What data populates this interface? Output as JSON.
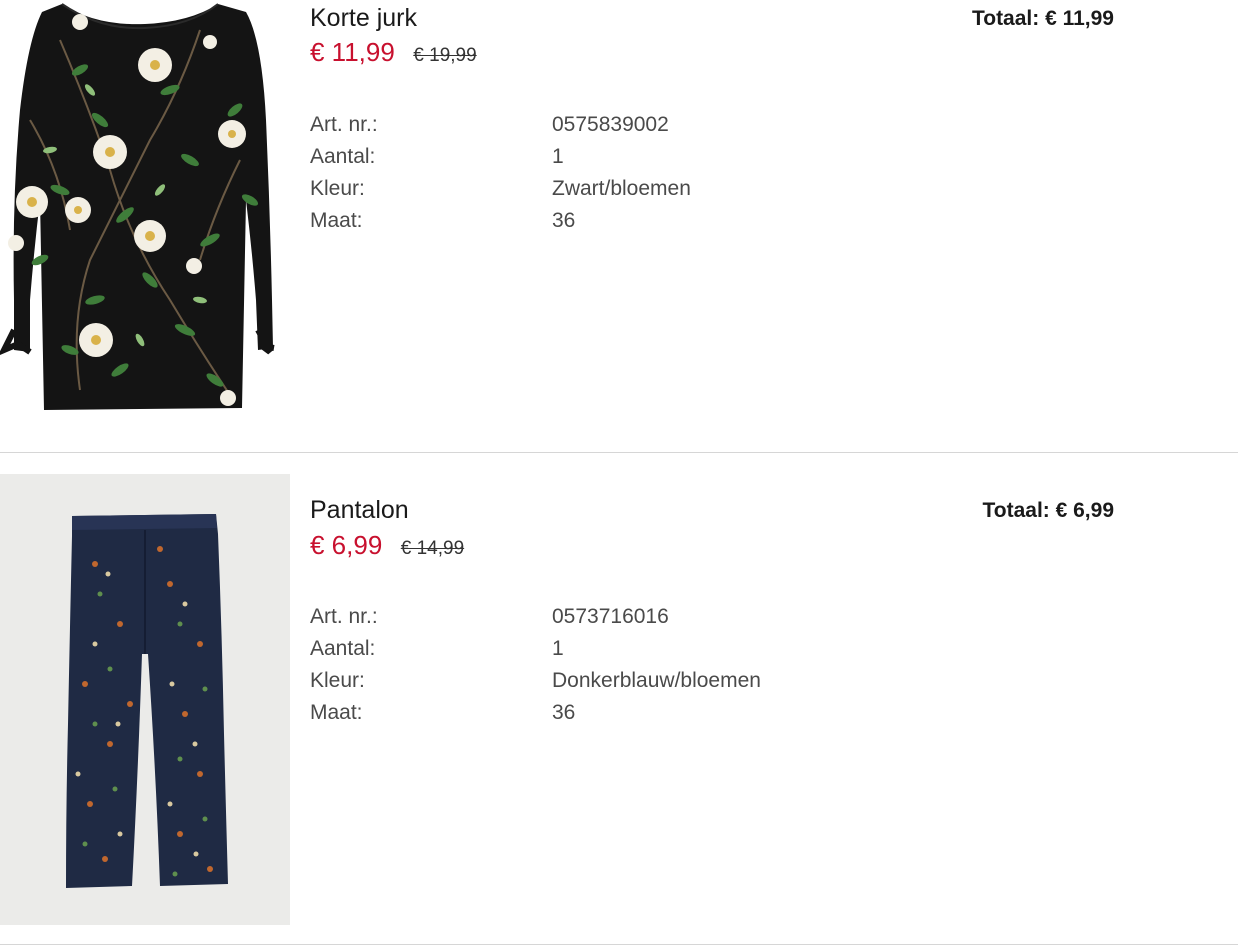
{
  "items": [
    {
      "name": "Korte jurk",
      "price_current": "€ 11,99",
      "price_original": "€ 19,99",
      "total": "Totaal: € 11,99",
      "image": "black floral dress",
      "details": [
        {
          "label": "Art. nr.:",
          "value": "0575839002"
        },
        {
          "label": "Aantal:",
          "value": "1"
        },
        {
          "label": "Kleur:",
          "value": "Zwart/bloemen"
        },
        {
          "label": "Maat:",
          "value": "36"
        }
      ]
    },
    {
      "name": "Pantalon",
      "price_current": "€ 6,99",
      "price_original": "€ 14,99",
      "total": "Totaal: € 6,99",
      "image": "navy floral trousers",
      "details": [
        {
          "label": "Art. nr.:",
          "value": "0573716016"
        },
        {
          "label": "Aantal:",
          "value": "1"
        },
        {
          "label": "Kleur:",
          "value": "Donkerblauw/bloemen"
        },
        {
          "label": "Maat:",
          "value": "36"
        }
      ]
    }
  ],
  "colors": {
    "sale_price": "#c8102e",
    "divider": "#d6d6d6",
    "text": "#1a1a1a",
    "muted_text": "#4a4a4a"
  }
}
